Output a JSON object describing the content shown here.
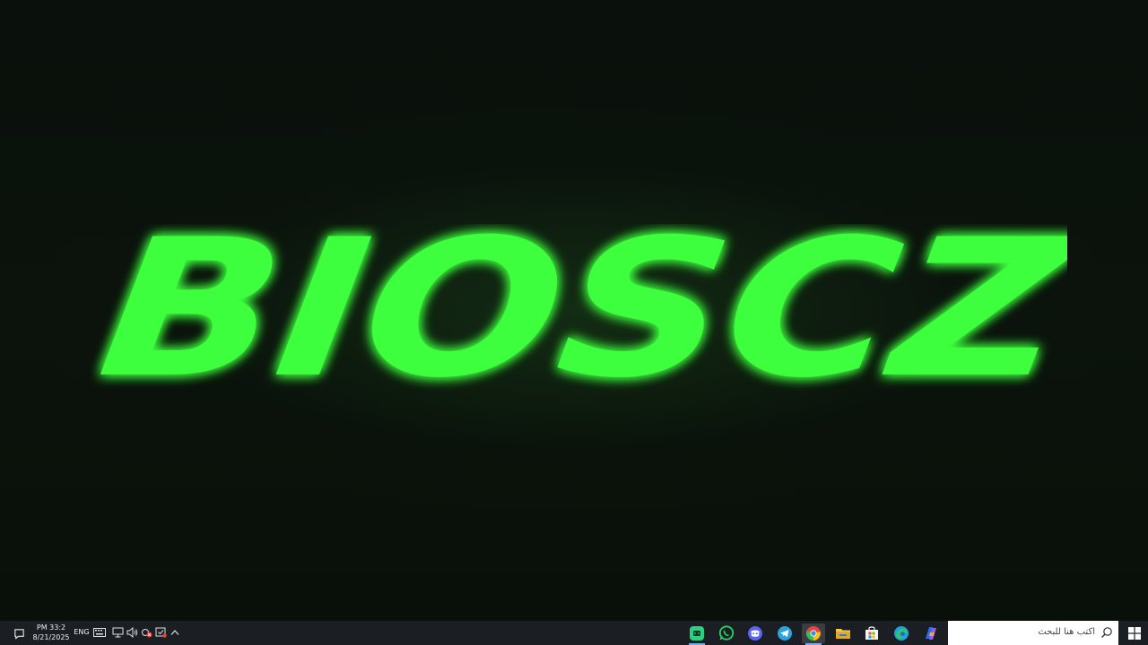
{
  "wallpaper": {
    "logo_text": "BIOSCZ",
    "logo_color": "#3cff3c"
  },
  "taskbar": {
    "clock_time": "PM 33:2",
    "clock_date": "8/21/2025",
    "language": "ENG",
    "search_placeholder": "اكتب هنا للبحث",
    "tray_icons": [
      "keyboard-icon",
      "network-icon",
      "volume-icon",
      "location-icon",
      "security-icon",
      "chevron-up-icon"
    ],
    "pinned_apps": [
      {
        "name": "gamepad-app-icon",
        "color": "#2bd17e"
      },
      {
        "name": "whatsapp-icon",
        "color": "#25d366"
      },
      {
        "name": "discord-icon",
        "color": "#5865f2"
      },
      {
        "name": "telegram-icon",
        "color": "#2aa3e0"
      },
      {
        "name": "chrome-icon",
        "color": "#e8453c"
      },
      {
        "name": "file-explorer-icon",
        "color": "#f2c94c"
      },
      {
        "name": "microsoft-store-icon",
        "color": "#ffffff"
      },
      {
        "name": "edge-icon",
        "color": "#1fa0e3"
      },
      {
        "name": "copilot-icon",
        "color": "#6b8cff"
      }
    ]
  }
}
